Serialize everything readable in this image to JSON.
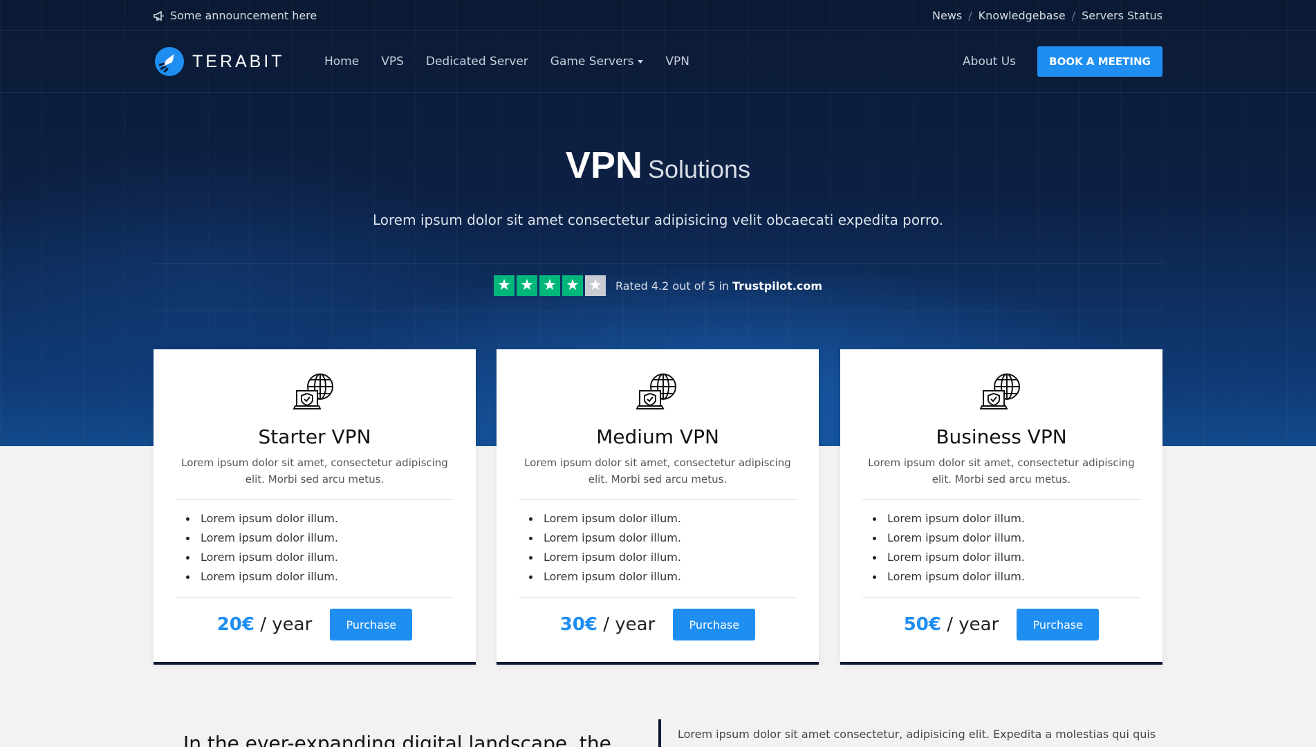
{
  "topbar": {
    "announcement": "Some announcement here",
    "links": [
      "News",
      "Knowledgebase",
      "Servers Status"
    ],
    "separator": "/"
  },
  "nav": {
    "logo_text": "TERABIT",
    "items": [
      {
        "label": "Home"
      },
      {
        "label": "VPS"
      },
      {
        "label": "Dedicated Server"
      },
      {
        "label": "Game Servers",
        "has_dropdown": true
      },
      {
        "label": "VPN"
      }
    ],
    "about_label": "About Us",
    "cta_label": "BOOK A MEETING"
  },
  "hero": {
    "title_bold": "VPN",
    "title_light": "Solutions",
    "subtitle": "Lorem ipsum dolor sit amet consectetur adipisicing velit obcaecati expedita porro.",
    "rating_prefix": "Rated 4.2 out of 5 in",
    "rating_site": "Trustpilot.com",
    "rating_stars_filled": 4,
    "rating_stars_total": 5
  },
  "plans": [
    {
      "name": "Starter VPN",
      "description": "Lorem ipsum dolor sit amet, consectetur adipiscing elit. Morbi sed arcu metus.",
      "features": [
        "Lorem ipsum dolor illum.",
        "Lorem ipsum dolor illum.",
        "Lorem ipsum dolor illum.",
        "Lorem ipsum dolor illum."
      ],
      "price": "20€",
      "period": "/ year",
      "button": "Purchase"
    },
    {
      "name": "Medium VPN",
      "description": "Lorem ipsum dolor sit amet, consectetur adipiscing elit. Morbi sed arcu metus.",
      "features": [
        "Lorem ipsum dolor illum.",
        "Lorem ipsum dolor illum.",
        "Lorem ipsum dolor illum.",
        "Lorem ipsum dolor illum."
      ],
      "price": "30€",
      "period": "/ year",
      "button": "Purchase"
    },
    {
      "name": "Business VPN",
      "description": "Lorem ipsum dolor sit amet, consectetur adipiscing elit. Morbi sed arcu metus.",
      "features": [
        "Lorem ipsum dolor illum.",
        "Lorem ipsum dolor illum.",
        "Lorem ipsum dolor illum.",
        "Lorem ipsum dolor illum."
      ],
      "price": "50€",
      "period": "/ year",
      "button": "Purchase"
    }
  ],
  "bottom": {
    "left_heading": "In the ever-expanding digital landscape, the",
    "right_text": "Lorem ipsum dolor sit amet consectetur, adipisicing elit. Expedita a molestias qui quis"
  },
  "colors": {
    "accent": "#1f8ef1",
    "navy": "#0b1a33",
    "trustpilot_green": "#00b67a"
  },
  "icons": {
    "announcement": "megaphone-icon",
    "plan": "globe-laptop-shield-icon",
    "star": "star-icon"
  }
}
